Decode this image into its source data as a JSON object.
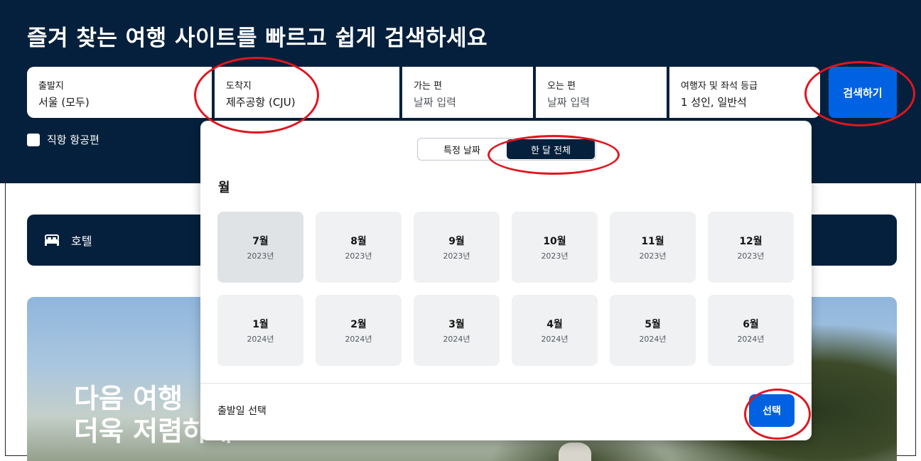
{
  "page": {
    "title": "즐겨 찾는 여행 사이트를 빠르고 쉽게 검색하세요"
  },
  "search": {
    "fields": [
      {
        "label": "출발지",
        "value": "서울 (모두)",
        "placeholder": false
      },
      {
        "label": "도착지",
        "value": "제주공항 (CJU)",
        "placeholder": false
      },
      {
        "label": "가는 편",
        "value": "날짜 입력",
        "placeholder": true
      },
      {
        "label": "오는 편",
        "value": "날짜 입력",
        "placeholder": true
      },
      {
        "label": "여행자 및 좌석 등급",
        "value": "1 성인, 일반석",
        "placeholder": false
      }
    ],
    "button_label": "검색하기",
    "direct_label": "직항 항공편",
    "direct_checked": false
  },
  "hotel": {
    "label": "호텔",
    "icon": "bed-icon"
  },
  "promo": {
    "line1": "다음 여행",
    "line2": "더욱 저렴하게"
  },
  "date_picker": {
    "toggle": {
      "options": [
        "특정 날짜",
        "한 달 전체"
      ],
      "active": "한 달 전체"
    },
    "heading": "월",
    "months": [
      {
        "name": "7월",
        "year": "2023년",
        "selected": true
      },
      {
        "name": "8월",
        "year": "2023년",
        "selected": false
      },
      {
        "name": "9월",
        "year": "2023년",
        "selected": false
      },
      {
        "name": "10월",
        "year": "2023년",
        "selected": false
      },
      {
        "name": "11월",
        "year": "2023년",
        "selected": false
      },
      {
        "name": "12월",
        "year": "2023년",
        "selected": false
      },
      {
        "name": "1월",
        "year": "2024년",
        "selected": false
      },
      {
        "name": "2월",
        "year": "2024년",
        "selected": false
      },
      {
        "name": "3월",
        "year": "2024년",
        "selected": false
      },
      {
        "name": "4월",
        "year": "2024년",
        "selected": false
      },
      {
        "name": "5월",
        "year": "2024년",
        "selected": false
      },
      {
        "name": "6월",
        "year": "2024년",
        "selected": false
      }
    ],
    "footer_label": "출발일 선택",
    "select_label": "선택"
  },
  "colors": {
    "brand_navy": "#05203c",
    "accent_blue": "#0062e3",
    "annotation_red": "#e0161f"
  }
}
